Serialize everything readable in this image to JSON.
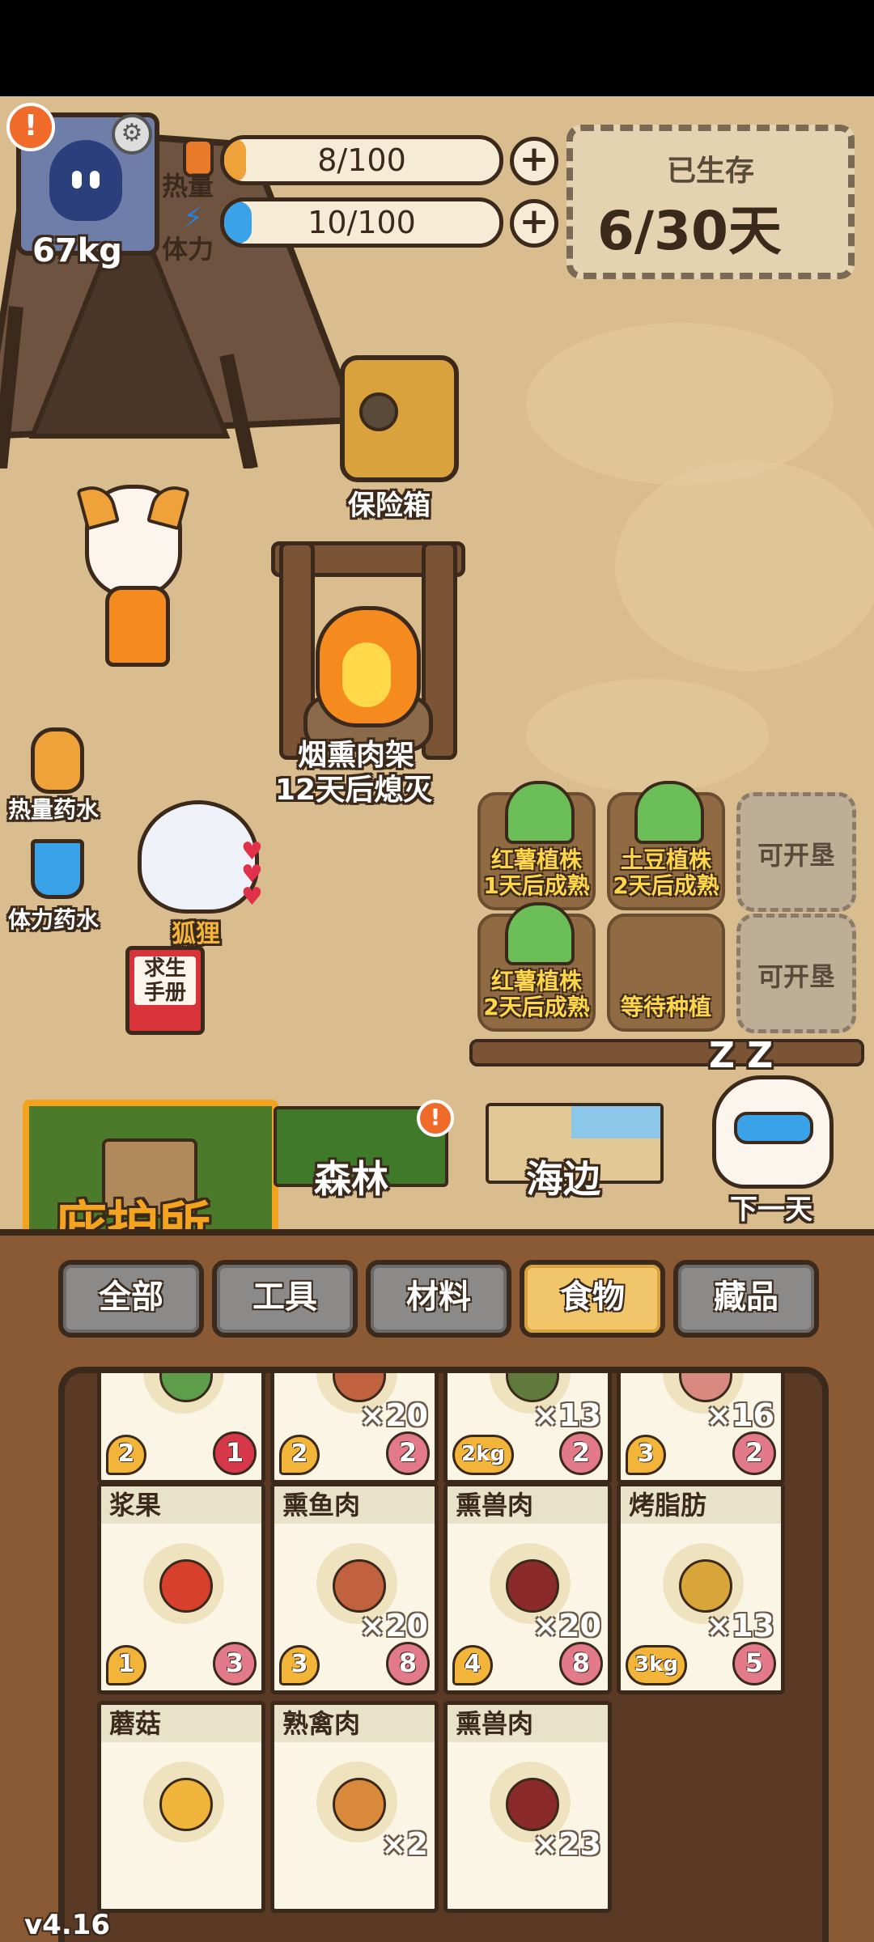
{
  "hud": {
    "weight": "67kg",
    "alert_symbol": "!",
    "gear_symbol": "⚙",
    "calories_label": "热量",
    "calories_value": "8/100",
    "calories_fraction": 0.08,
    "stamina_label": "体力",
    "stamina_value": "10/100",
    "stamina_fraction": 0.1,
    "plus_symbol": "+",
    "survive_label": "已生存",
    "survive_value": "6/30天"
  },
  "scene": {
    "safe_label": "保险箱",
    "smoker_label": "烟熏肉架",
    "smoker_status": "12天后熄灭",
    "calorie_potion": "热量药水",
    "stamina_potion": "体力药水",
    "fox_label": "狐狸",
    "manual_label": "求生\n手册",
    "next_day_label": "下一天",
    "sleep_symbol": "Z Z"
  },
  "plots": [
    {
      "name": "红薯植株",
      "status": "1天后成熟"
    },
    {
      "name": "土豆植株",
      "status": "2天后成熟"
    },
    {
      "name": "可开垦",
      "status": ""
    },
    {
      "name": "红薯植株",
      "status": "2天后成熟"
    },
    {
      "name": "等待种植",
      "status": ""
    },
    {
      "name": "可开垦",
      "status": ""
    }
  ],
  "locations": {
    "shelter": "庇护所",
    "forest": "森林",
    "seaside": "海边",
    "forest_alert": "!"
  },
  "tabs": [
    "全部",
    "工具",
    "材料",
    "食物",
    "藏品"
  ],
  "active_tab": "食物",
  "inventory": [
    {
      "name": "",
      "qty": "",
      "heat": "2",
      "count": "1",
      "color": "#5c9e4a"
    },
    {
      "name": "",
      "qty": "×20",
      "heat": "2",
      "count": "2",
      "color": "#c0613f"
    },
    {
      "name": "",
      "qty": "×13",
      "heat": "2kg",
      "count": "2",
      "color": "#5f7a3a"
    },
    {
      "name": "",
      "qty": "×16",
      "heat": "3",
      "count": "2",
      "color": "#d88a80"
    },
    {
      "name": "浆果",
      "qty": "",
      "heat": "1",
      "count": "3",
      "color": "#d8402e"
    },
    {
      "name": "熏鱼肉",
      "qty": "×20",
      "heat": "3",
      "count": "8",
      "color": "#c0613f"
    },
    {
      "name": "熏兽肉",
      "qty": "×20",
      "heat": "4",
      "count": "8",
      "color": "#8a2a2a"
    },
    {
      "name": "烤脂肪",
      "qty": "×13",
      "heat": "3kg",
      "count": "5",
      "color": "#d8a53a"
    },
    {
      "name": "蘑菇",
      "qty": "",
      "heat": "",
      "count": "",
      "color": "#f0b43a"
    },
    {
      "name": "熟禽肉",
      "qty": "×2",
      "heat": "",
      "count": "",
      "color": "#d88a3a"
    },
    {
      "name": "熏兽肉",
      "qty": "×23",
      "heat": "",
      "count": "",
      "color": "#8a2a2a"
    }
  ],
  "version": "v4.16"
}
